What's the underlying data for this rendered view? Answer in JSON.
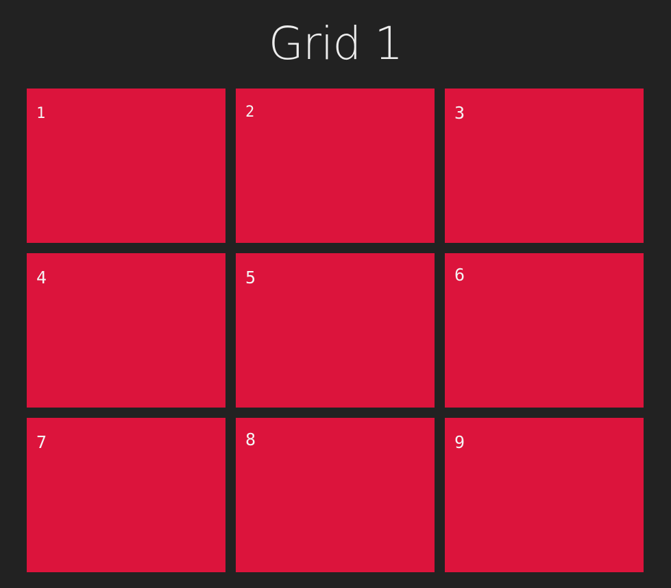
{
  "page": {
    "title": "Grid 1",
    "colors": {
      "background": "#222222",
      "cell": "#dc143c",
      "text": "#f4f4f4"
    }
  },
  "grid": {
    "cells": [
      {
        "label": "1"
      },
      {
        "label": "2"
      },
      {
        "label": "3"
      },
      {
        "label": "4"
      },
      {
        "label": "5"
      },
      {
        "label": "6"
      },
      {
        "label": "7"
      },
      {
        "label": "8"
      },
      {
        "label": "9"
      }
    ]
  }
}
